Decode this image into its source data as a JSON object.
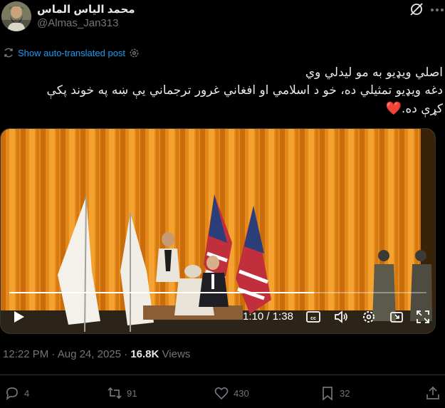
{
  "author": {
    "display_name": "محمد الياس الماس",
    "handle": "@Almas_Jan313"
  },
  "translate": {
    "label": "Show auto-translated post"
  },
  "post": {
    "line1": "اصلي ویډیو به مو لیدلي وي",
    "line2": "دغه ویډیو تمثیلي ده، خو د اسلامي او افغاني غرور ترجماني یې ښه په خوند پکې",
    "line3": "کړې ده.",
    "heart": "❤️"
  },
  "video": {
    "current_time": "1:10",
    "separator": "/",
    "duration": "1:38",
    "progress": 0.73
  },
  "meta": {
    "time": "12:22 PM",
    "dot": "·",
    "date": "Aug 24, 2025",
    "dot2": "·",
    "views_count": "16.8K",
    "views_label": "Views"
  },
  "actions": {
    "replies": "4",
    "reposts": "91",
    "likes": "430",
    "bookmarks": "32"
  },
  "colors": {
    "accent": "#1d9bf0",
    "background": "#000000",
    "muted": "#71767b",
    "curtain": "#e88a1a"
  }
}
